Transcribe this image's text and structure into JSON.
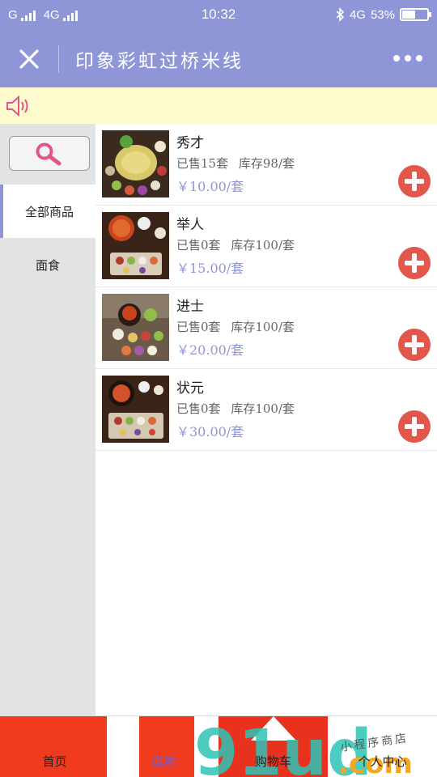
{
  "status_bar": {
    "carrier": "G",
    "network": "4G",
    "time": "10:32",
    "right_network": "4G",
    "battery": "53%",
    "battery_level": 0.53
  },
  "title_bar": {
    "title": "印象彩虹过桥米线"
  },
  "sidebar": {
    "categories": [
      {
        "label": "全部商品",
        "active": true
      },
      {
        "label": "面食",
        "active": false
      }
    ]
  },
  "products": [
    {
      "name": "秀才",
      "sold": "已售15套",
      "stock": "库存98/套",
      "price": "￥10.00/套"
    },
    {
      "name": "举人",
      "sold": "已售0套",
      "stock": "库存100/套",
      "price": "￥15.00/套"
    },
    {
      "name": "进士",
      "sold": "已售0套",
      "stock": "库存100/套",
      "price": "￥20.00/套"
    },
    {
      "name": "状元",
      "sold": "已售0套",
      "stock": "库存100/套",
      "price": "￥30.00/套"
    }
  ],
  "tabs": [
    {
      "label": "首页",
      "active": false
    },
    {
      "label": "选购",
      "active": true
    },
    {
      "label": "购物车",
      "active": false
    },
    {
      "label": "个人中心",
      "active": false
    }
  ],
  "watermark": {
    "text": "小程序商店",
    "logo_text": "91ud.com"
  },
  "colors": {
    "header": "#8e96d8",
    "notice_bg": "#fdfbcd",
    "accent_pink": "#e0568c",
    "add_button": "#e2574c",
    "price": "#8e96d8",
    "active_tab": "#6c63d6"
  },
  "icons": {
    "close": "close-icon",
    "more": "more-icon",
    "speaker": "speaker-icon",
    "search": "search-icon",
    "add": "plus-icon"
  }
}
